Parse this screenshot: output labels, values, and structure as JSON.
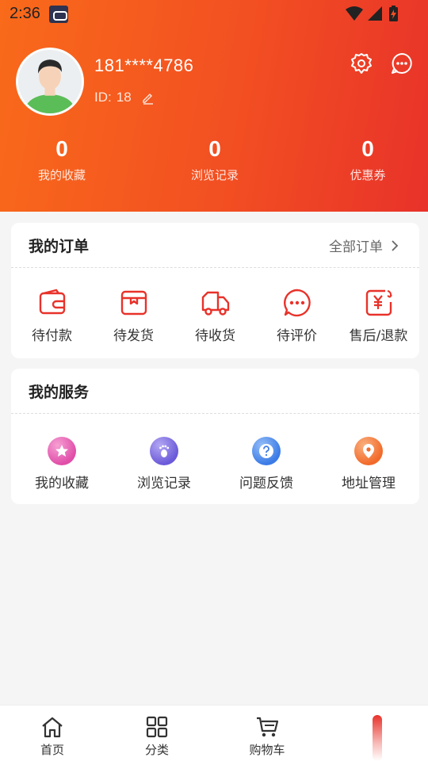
{
  "colors": {
    "header_start": "#f96a1a",
    "header_end": "#e8322a",
    "accent_red": "#e8322a",
    "background": "#f5f5f5"
  },
  "status_bar": {
    "time": "2:36",
    "icons": [
      "wifi-icon",
      "signal-icon",
      "battery-charging-icon"
    ]
  },
  "profile": {
    "phone": "181****4786",
    "id_label": "ID:",
    "id_value": "18"
  },
  "stats": [
    {
      "value": "0",
      "label": "我的收藏"
    },
    {
      "value": "0",
      "label": "浏览记录"
    },
    {
      "value": "0",
      "label": "优惠券"
    }
  ],
  "orders": {
    "title": "我的订单",
    "all_label": "全部订单",
    "items": [
      {
        "label": "待付款",
        "icon": "wallet-icon"
      },
      {
        "label": "待发货",
        "icon": "package-icon"
      },
      {
        "label": "待收货",
        "icon": "truck-icon"
      },
      {
        "label": "待评价",
        "icon": "comment-icon"
      },
      {
        "label": "售后/退款",
        "icon": "refund-icon"
      }
    ]
  },
  "services": {
    "title": "我的服务",
    "items": [
      {
        "label": "我的收藏",
        "icon": "star-icon",
        "color": "#e04ea8"
      },
      {
        "label": "浏览记录",
        "icon": "footprint-icon",
        "color": "#6b5ad9"
      },
      {
        "label": "问题反馈",
        "icon": "question-icon",
        "color": "#3b7be6"
      },
      {
        "label": "地址管理",
        "icon": "location-pin-icon",
        "color": "#f26a2a"
      }
    ]
  },
  "tabbar": {
    "tabs": [
      {
        "label": "首页",
        "icon": "home-icon"
      },
      {
        "label": "分类",
        "icon": "grid-icon"
      },
      {
        "label": "购物车",
        "icon": "cart-icon"
      }
    ]
  }
}
